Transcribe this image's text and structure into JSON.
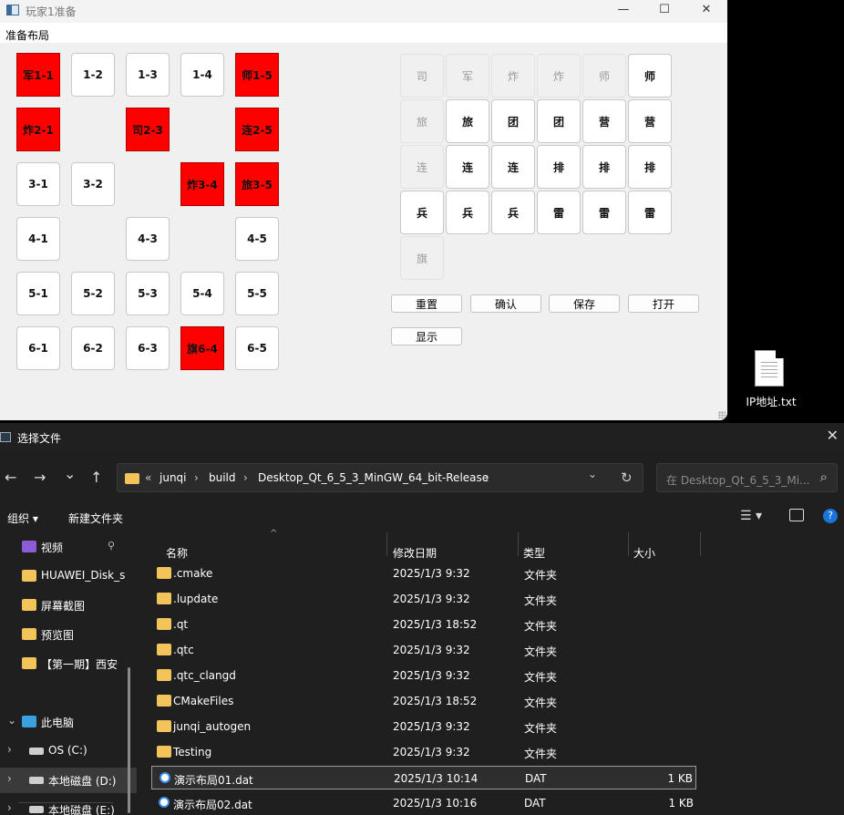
{
  "game_window": {
    "title": "玩家1准备",
    "controls": {
      "minimize": "—",
      "maximize": "☐",
      "close": "✕"
    },
    "menu": "准备布局",
    "board": [
      {
        "label": "军1-1",
        "red": true
      },
      {
        "label": "1-2",
        "red": false
      },
      {
        "label": "1-3",
        "red": false
      },
      {
        "label": "1-4",
        "red": false
      },
      {
        "label": "师1-5",
        "red": true
      },
      {
        "label": "炸2-1",
        "red": true
      },
      {
        "label": "",
        "empty": true
      },
      {
        "label": "司2-3",
        "red": true
      },
      {
        "label": "",
        "empty": true
      },
      {
        "label": "连2-5",
        "red": true
      },
      {
        "label": "3-1",
        "red": false
      },
      {
        "label": "3-2",
        "red": false
      },
      {
        "label": "",
        "empty": true
      },
      {
        "label": "炸3-4",
        "red": true
      },
      {
        "label": "旅3-5",
        "red": true
      },
      {
        "label": "4-1",
        "red": false
      },
      {
        "label": "",
        "empty": true
      },
      {
        "label": "4-3",
        "red": false
      },
      {
        "label": "",
        "empty": true
      },
      {
        "label": "4-5",
        "red": false
      },
      {
        "label": "5-1",
        "red": false
      },
      {
        "label": "5-2",
        "red": false
      },
      {
        "label": "5-3",
        "red": false
      },
      {
        "label": "5-4",
        "red": false
      },
      {
        "label": "5-5",
        "red": false
      },
      {
        "label": "6-1",
        "red": false
      },
      {
        "label": "6-2",
        "red": false
      },
      {
        "label": "6-3",
        "red": false
      },
      {
        "label": "旗6-4",
        "red": true
      },
      {
        "label": "6-5",
        "red": false
      }
    ],
    "pieces": [
      {
        "label": "司",
        "disabled": true
      },
      {
        "label": "军",
        "disabled": true
      },
      {
        "label": "炸",
        "disabled": true
      },
      {
        "label": "炸",
        "disabled": true
      },
      {
        "label": "师",
        "disabled": true
      },
      {
        "label": "师",
        "disabled": false
      },
      {
        "label": "旅",
        "disabled": true
      },
      {
        "label": "旅",
        "disabled": false
      },
      {
        "label": "团",
        "disabled": false
      },
      {
        "label": "团",
        "disabled": false
      },
      {
        "label": "营",
        "disabled": false
      },
      {
        "label": "营",
        "disabled": false
      },
      {
        "label": "连",
        "disabled": true
      },
      {
        "label": "连",
        "disabled": false
      },
      {
        "label": "连",
        "disabled": false
      },
      {
        "label": "排",
        "disabled": false
      },
      {
        "label": "排",
        "disabled": false
      },
      {
        "label": "排",
        "disabled": false
      },
      {
        "label": "兵",
        "disabled": false
      },
      {
        "label": "兵",
        "disabled": false
      },
      {
        "label": "兵",
        "disabled": false
      },
      {
        "label": "雷",
        "disabled": false
      },
      {
        "label": "雷",
        "disabled": false
      },
      {
        "label": "雷",
        "disabled": false
      },
      {
        "label": "旗",
        "disabled": true
      }
    ],
    "buttons": {
      "reset": "重置",
      "confirm": "确认",
      "save": "保存",
      "open": "打开",
      "show": "显示"
    }
  },
  "desktop": {
    "file_label": "IP地址.txt",
    "file_icon": "text-file-icon"
  },
  "dialog": {
    "title": "选择文件",
    "close": "✕",
    "nav": {
      "back": "←",
      "forward": "→",
      "recent": "⌄",
      "up": "↑"
    },
    "breadcrumb": {
      "overflow": "«",
      "parts": [
        "junqi",
        "build",
        "Desktop_Qt_6_5_3_MinGW_64_bit-Release"
      ],
      "sep": "›",
      "dropdown": "⌄",
      "refresh": "↻"
    },
    "search_placeholder": "在 Desktop_Qt_6_5_3_Mi...",
    "search_icon": "⌕",
    "toolbar": {
      "organize": "组织 ▾",
      "new_folder": "新建文件夹",
      "help": "?"
    },
    "sidebar": [
      {
        "label": "视频",
        "kind": "video",
        "pin": true
      },
      {
        "label": "HUAWEI_Disk_s",
        "kind": "folder"
      },
      {
        "label": "屏幕截图",
        "kind": "folder"
      },
      {
        "label": "预览图",
        "kind": "folder"
      },
      {
        "label": "【第一期】西安",
        "kind": "folder"
      },
      {
        "label": "此电脑",
        "kind": "pc",
        "chevron": "⌄"
      },
      {
        "label": "OS (C:)",
        "kind": "drive",
        "chevron": "›"
      },
      {
        "label": "本地磁盘 (D:)",
        "kind": "drive",
        "chevron": "›",
        "selected": true
      },
      {
        "label": "本地磁盘 (E:)",
        "kind": "drive",
        "chevron": "›"
      }
    ],
    "columns": {
      "name": "名称",
      "date": "修改日期",
      "type": "类型",
      "size": "大小"
    },
    "sort_caret": "^",
    "files": [
      {
        "name": ".cmake",
        "date": "2025/1/3 9:32",
        "type": "文件夹",
        "size": "",
        "kind": "folder"
      },
      {
        "name": ".lupdate",
        "date": "2025/1/3 9:32",
        "type": "文件夹",
        "size": "",
        "kind": "folder"
      },
      {
        "name": ".qt",
        "date": "2025/1/3 18:52",
        "type": "文件夹",
        "size": "",
        "kind": "folder"
      },
      {
        "name": ".qtc",
        "date": "2025/1/3 9:32",
        "type": "文件夹",
        "size": "",
        "kind": "folder"
      },
      {
        "name": ".qtc_clangd",
        "date": "2025/1/3 9:32",
        "type": "文件夹",
        "size": "",
        "kind": "folder"
      },
      {
        "name": "CMakeFiles",
        "date": "2025/1/3 18:52",
        "type": "文件夹",
        "size": "",
        "kind": "folder"
      },
      {
        "name": "junqi_autogen",
        "date": "2025/1/3 9:32",
        "type": "文件夹",
        "size": "",
        "kind": "folder"
      },
      {
        "name": "Testing",
        "date": "2025/1/3 9:32",
        "type": "文件夹",
        "size": "",
        "kind": "folder"
      },
      {
        "name": "演示布局01.dat",
        "date": "2025/1/3 10:14",
        "type": "DAT",
        "size": "1 KB",
        "kind": "dat",
        "selected": true
      },
      {
        "name": "演示布局02.dat",
        "date": "2025/1/3 10:16",
        "type": "DAT",
        "size": "1 KB",
        "kind": "dat"
      }
    ],
    "colors": {
      "folder": "#f2c45a",
      "dat": "#3a8ee6",
      "red_cell": "#ff0000"
    }
  }
}
